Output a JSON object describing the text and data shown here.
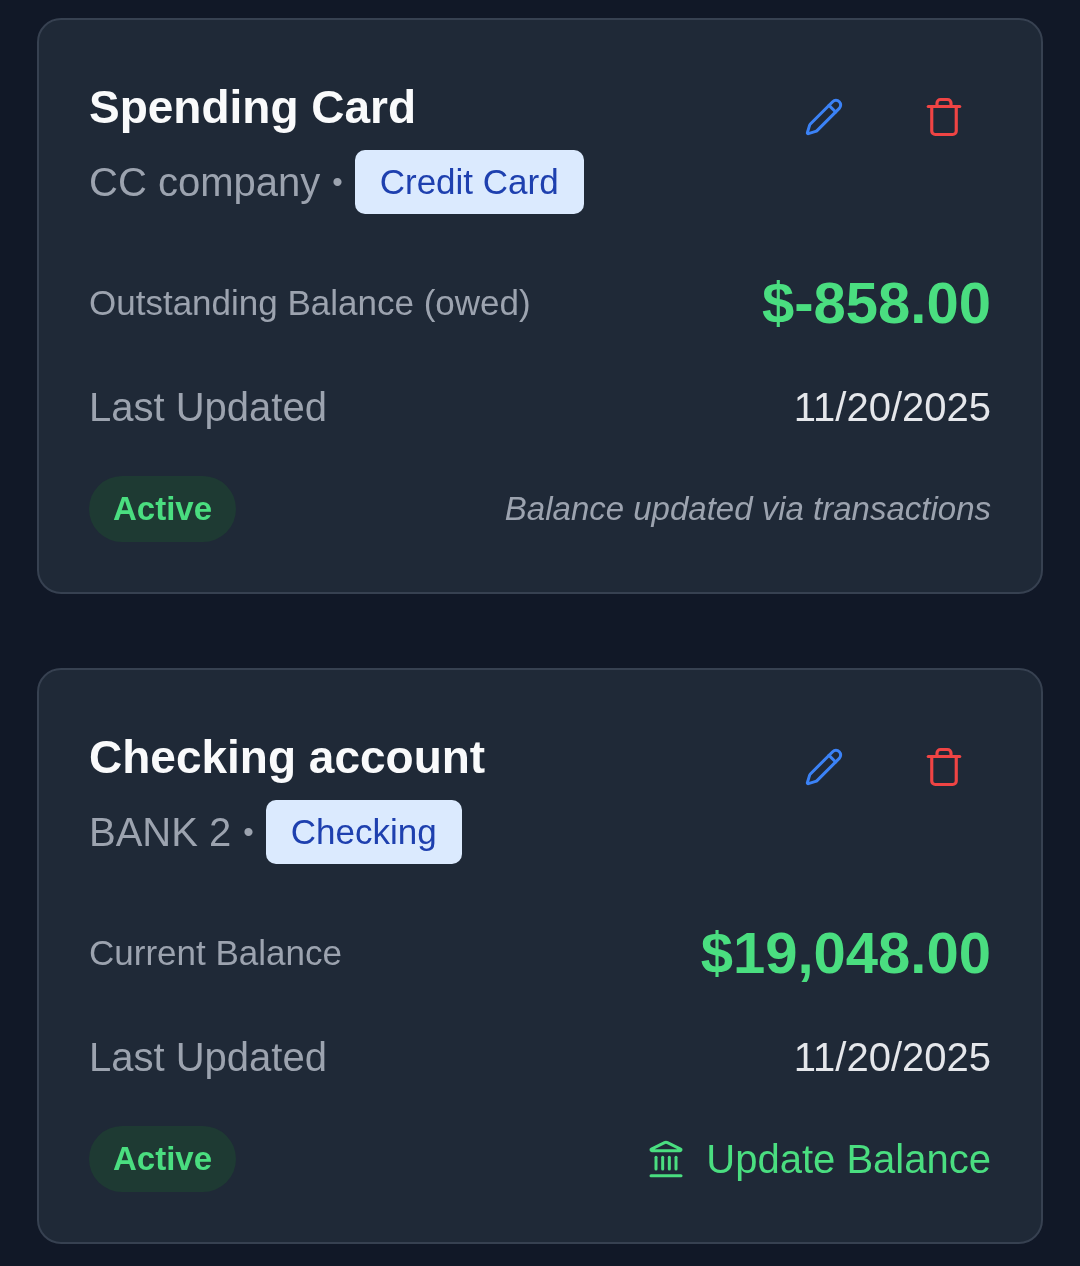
{
  "accounts": [
    {
      "name": "Spending Card",
      "institution": "CC company",
      "separator": "•",
      "type_badge": "Credit Card",
      "balance_label": "Outstanding Balance (owed)",
      "balance": "$-858.00",
      "updated_label": "Last Updated",
      "updated_date": "11/20/2025",
      "status": "Active",
      "footer": {
        "kind": "note",
        "text": "Balance updated via transactions"
      }
    },
    {
      "name": "Checking account",
      "institution": "BANK 2",
      "separator": "•",
      "type_badge": "Checking",
      "balance_label": "Current Balance",
      "balance": "$19,048.00",
      "updated_label": "Last Updated",
      "updated_date": "11/20/2025",
      "status": "Active",
      "footer": {
        "kind": "action",
        "label": "Update Balance"
      }
    }
  ]
}
